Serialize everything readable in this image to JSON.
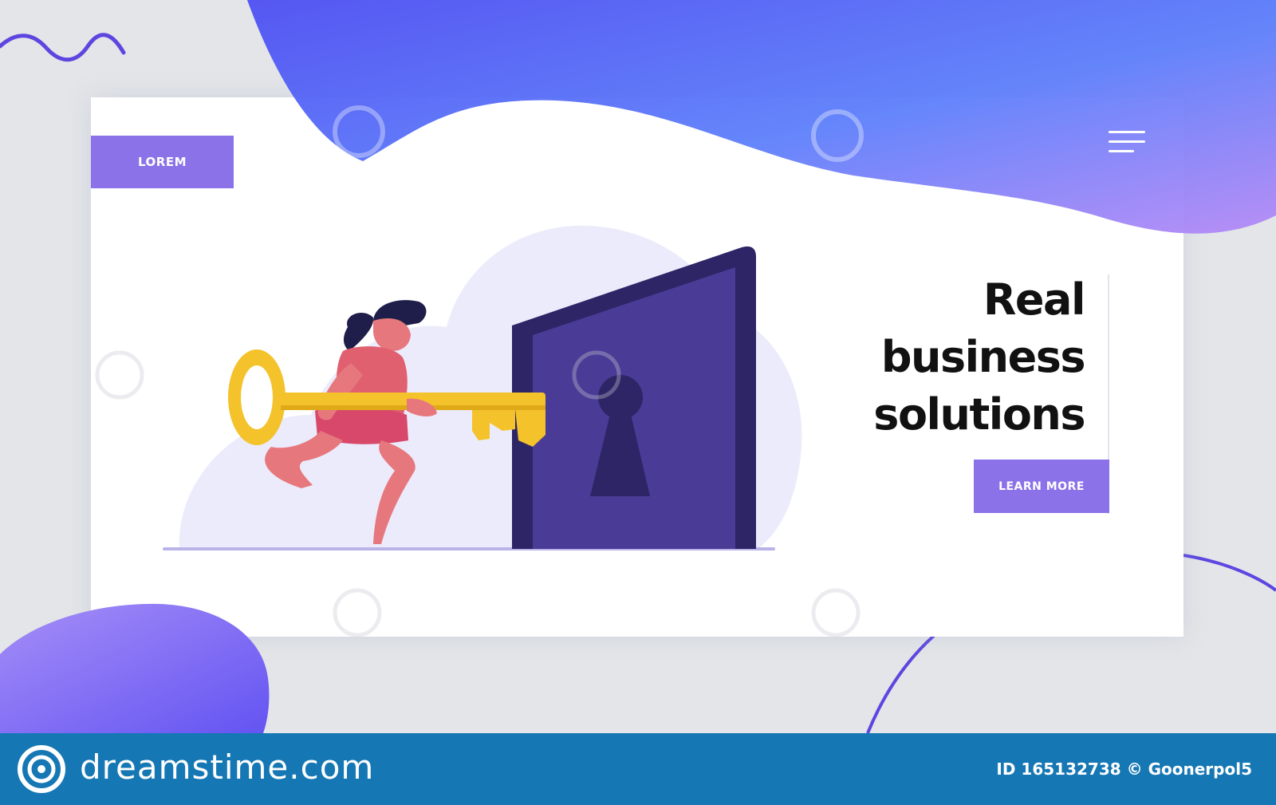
{
  "header": {
    "logo_label": "LOREM",
    "menu_icon": "hamburger-menu-icon"
  },
  "hero": {
    "title_lines": [
      "Real",
      "business",
      "solutions"
    ],
    "cta_label": "LEARN MORE"
  },
  "illustration": {
    "subject": "woman-carrying-golden-key-to-keyhole-door",
    "key_color": "#f5c327",
    "door_color": "#4a3c96"
  },
  "watermark": {
    "brand": "dreamstime.com",
    "image_id": "ID 165132738 © Goonerpol5"
  },
  "colors": {
    "accent": "#8b72e8",
    "blob_start": "#5b52f0",
    "blob_end": "#a98af5",
    "footer": "#1577b4",
    "background": "#e3e5e8"
  }
}
